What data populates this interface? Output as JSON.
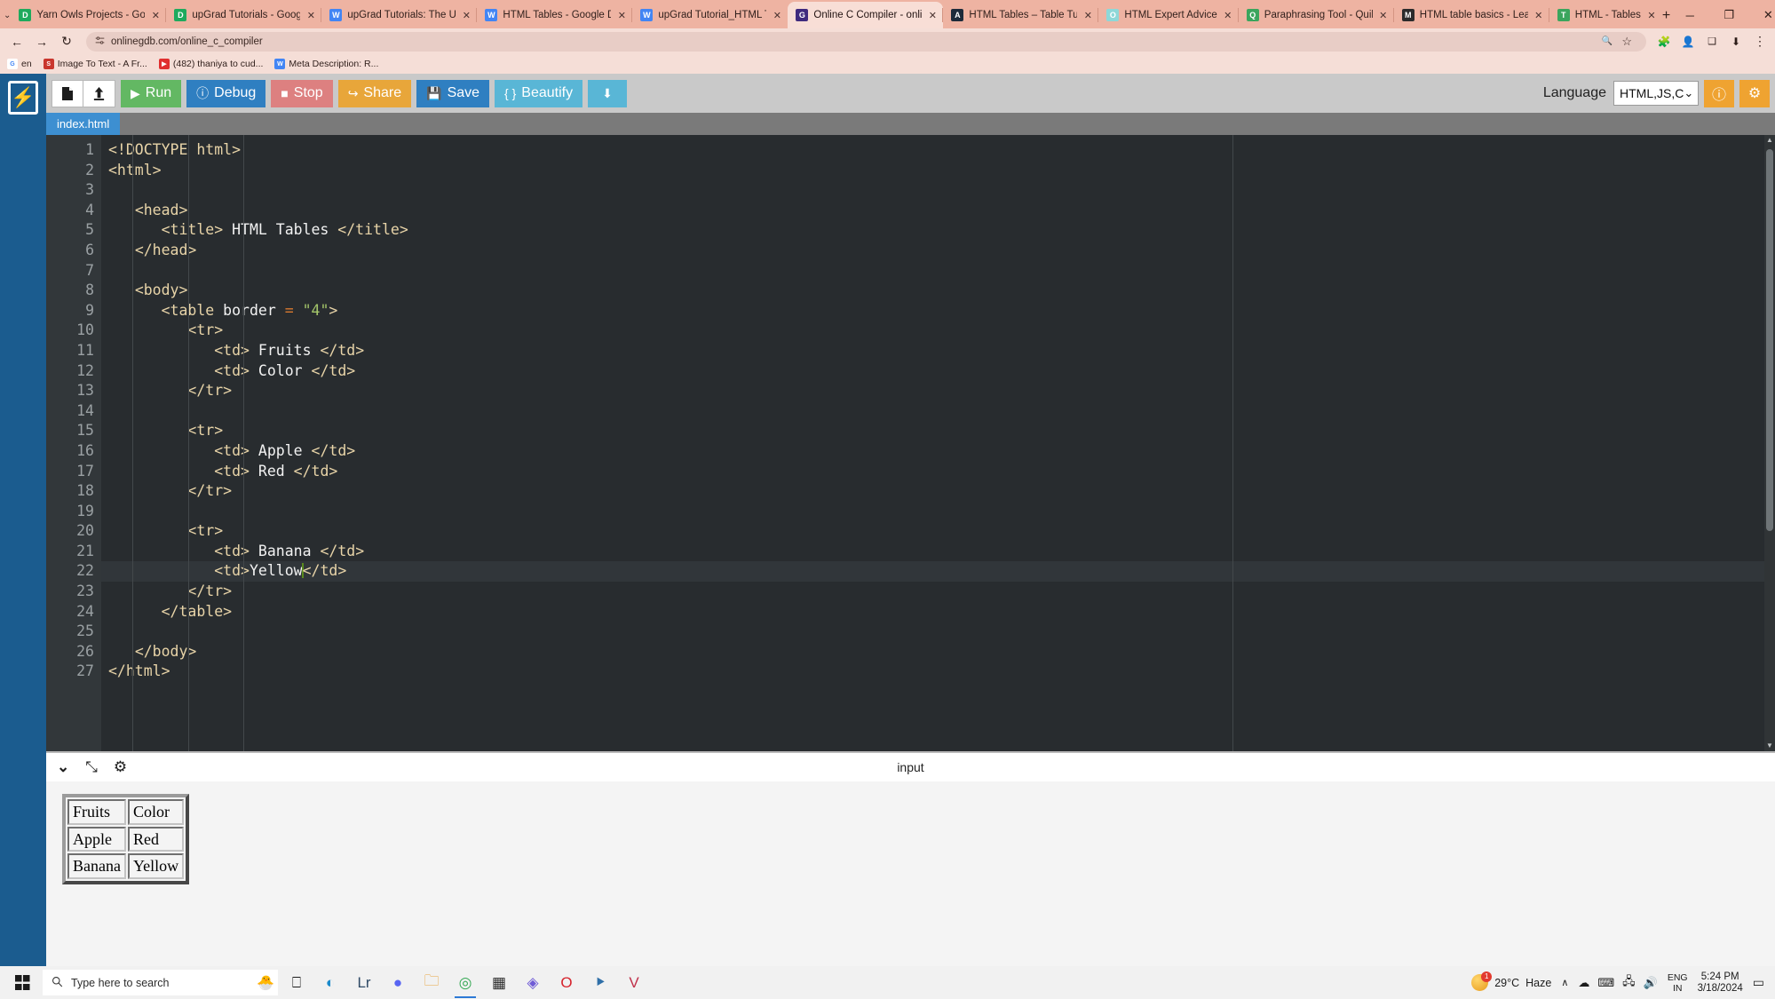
{
  "browser": {
    "tabs": [
      {
        "title": "Yarn Owls Projects - Goog",
        "fav": "D",
        "fav_color": "#1faa5d",
        "active": false
      },
      {
        "title": "upGrad Tutorials - Google",
        "fav": "D",
        "fav_color": "#1faa5d",
        "active": false
      },
      {
        "title": "upGrad Tutorials: The Ulti",
        "fav": "W",
        "fav_color": "#4285f4",
        "active": false
      },
      {
        "title": "HTML Tables - Google Do",
        "fav": "W",
        "fav_color": "#4285f4",
        "active": false
      },
      {
        "title": "upGrad Tutorial_HTML Tal",
        "fav": "W",
        "fav_color": "#4285f4",
        "active": false
      },
      {
        "title": "Online C Compiler - onlin",
        "fav": "G",
        "fav_color": "#3f2a7e",
        "active": true
      },
      {
        "title": "HTML Tables – Table Tuto",
        "fav": "A",
        "fav_color": "#1c2a3a",
        "active": false
      },
      {
        "title": "HTML Expert Advice",
        "fav": "O",
        "fav_color": "#8ed8d8",
        "active": false
      },
      {
        "title": "Paraphrasing Tool - QuillB",
        "fav": "Q",
        "fav_color": "#3ba55d",
        "active": false
      },
      {
        "title": "HTML table basics - Learn",
        "fav": "M",
        "fav_color": "#2b2b2b",
        "active": false
      },
      {
        "title": "HTML - Tables",
        "fav": "T",
        "fav_color": "#3ba55d",
        "active": false
      }
    ],
    "new_tab_label": "+",
    "tab_close_label": "✕",
    "tabstrip_chevron": "⌄",
    "window_controls": {
      "minimize": "─",
      "maximize": "❐",
      "close": "✕"
    },
    "nav": {
      "back": "←",
      "forward": "→",
      "reload": "↻"
    },
    "omnibox": {
      "site_settings_icon": "site-settings-icon",
      "url": "onlinegdb.com/online_c_compiler",
      "zoom_icon": "🔍",
      "bookmark_star": "☆"
    },
    "toolbar_icons": {
      "extensions": "🧩",
      "profile": "👤",
      "split": "❑",
      "downloads": "⬇",
      "menu": "⋮"
    },
    "bookmarks": [
      {
        "label": "en",
        "ico": "G",
        "color": "#ffffff",
        "fg": "#4285f4"
      },
      {
        "label": "Image To Text - A Fr...",
        "ico": "S",
        "color": "#c9362d",
        "fg": "#ffffff"
      },
      {
        "label": "(482) thaniya to cud...",
        "ico": "▶",
        "color": "#e02f2f",
        "fg": "#ffffff"
      },
      {
        "label": "Meta Description: R...",
        "ico": "W",
        "color": "#4285f4",
        "fg": "#ffffff"
      }
    ]
  },
  "ide": {
    "logo_glyph": "⚡",
    "toolbar": {
      "new_file_icon": "new-file-icon",
      "upload_icon": "upload-icon",
      "buttons": [
        {
          "label": "Run",
          "glyph": "▶",
          "bg": "#63b863"
        },
        {
          "label": "Debug",
          "glyph": "ⓘ",
          "bg": "#2f7fc1"
        },
        {
          "label": "Stop",
          "glyph": "■",
          "bg": "#dd8080"
        },
        {
          "label": "Share",
          "glyph": "↪",
          "bg": "#e8a63a"
        },
        {
          "label": "Save",
          "glyph": "💾",
          "bg": "#2f7fc1"
        },
        {
          "label": "Beautify",
          "glyph": "{ }",
          "bg": "#59b6d6"
        },
        {
          "label": "",
          "glyph": "⬇",
          "bg": "#59b6d6"
        }
      ],
      "language_label": "Language",
      "language_value": "HTML,JS,C",
      "language_caret": "⌄",
      "info_button": "ⓘ",
      "settings_button": "⚙"
    },
    "file_tab": "index.html",
    "editor": {
      "active_line": 22,
      "lines": [
        {
          "n": 1,
          "fold": false,
          "html": "<span class=\"tag\">&lt;!DOCTYPE html&gt;</span>"
        },
        {
          "n": 2,
          "fold": true,
          "html": "<span class=\"tag\">&lt;html&gt;</span>"
        },
        {
          "n": 3,
          "fold": false,
          "html": ""
        },
        {
          "n": 4,
          "fold": true,
          "html": "   <span class=\"tag\">&lt;head&gt;</span>"
        },
        {
          "n": 5,
          "fold": false,
          "html": "      <span class=\"tag\">&lt;title&gt;</span><span class=\"txt\"> HTML Tables </span><span class=\"tag\">&lt;/title&gt;</span>"
        },
        {
          "n": 6,
          "fold": false,
          "html": "   <span class=\"tag\">&lt;/head&gt;</span>"
        },
        {
          "n": 7,
          "fold": false,
          "html": ""
        },
        {
          "n": 8,
          "fold": false,
          "html": "   <span class=\"tag\">&lt;body&gt;</span>"
        },
        {
          "n": 9,
          "fold": true,
          "html": "      <span class=\"tag\">&lt;table</span> <span class=\"attr\">border</span> <span class=\"eq\">=</span> <span class=\"str\">\"4\"</span><span class=\"tag\">&gt;</span>"
        },
        {
          "n": 10,
          "fold": true,
          "html": "         <span class=\"tag\">&lt;tr&gt;</span>"
        },
        {
          "n": 11,
          "fold": false,
          "html": "            <span class=\"tag\">&lt;td&gt;</span><span class=\"txt\"> Fruits </span><span class=\"tag\">&lt;/td&gt;</span>"
        },
        {
          "n": 12,
          "fold": false,
          "html": "            <span class=\"tag\">&lt;td&gt;</span><span class=\"txt\"> Color </span><span class=\"tag\">&lt;/td&gt;</span>"
        },
        {
          "n": 13,
          "fold": false,
          "html": "         <span class=\"tag\">&lt;/tr&gt;</span>"
        },
        {
          "n": 14,
          "fold": false,
          "html": ""
        },
        {
          "n": 15,
          "fold": true,
          "html": "         <span class=\"tag\">&lt;tr&gt;</span>"
        },
        {
          "n": 16,
          "fold": false,
          "html": "            <span class=\"tag\">&lt;td&gt;</span><span class=\"txt\"> Apple </span><span class=\"tag\">&lt;/td&gt;</span>"
        },
        {
          "n": 17,
          "fold": false,
          "html": "            <span class=\"tag\">&lt;td&gt;</span><span class=\"txt\"> Red </span><span class=\"tag\">&lt;/td&gt;</span>"
        },
        {
          "n": 18,
          "fold": false,
          "html": "         <span class=\"tag\">&lt;/tr&gt;</span>"
        },
        {
          "n": 19,
          "fold": false,
          "html": ""
        },
        {
          "n": 20,
          "fold": true,
          "html": "         <span class=\"tag\">&lt;tr&gt;</span>"
        },
        {
          "n": 21,
          "fold": false,
          "html": "            <span class=\"tag\">&lt;td&gt;</span><span class=\"txt\"> Banana </span><span class=\"tag\">&lt;/td&gt;</span>"
        },
        {
          "n": 22,
          "fold": false,
          "html": "            <span class=\"tag\">&lt;td&gt;</span><span class=\"txt\">Yellow</span><span class=\"caret\"></span><span class=\"tag\">&lt;/td&gt;</span>"
        },
        {
          "n": 23,
          "fold": false,
          "html": "         <span class=\"tag\">&lt;/tr&gt;</span>"
        },
        {
          "n": 24,
          "fold": false,
          "html": "      <span class=\"tag\">&lt;/table&gt;</span>"
        },
        {
          "n": 25,
          "fold": false,
          "html": ""
        },
        {
          "n": 26,
          "fold": false,
          "html": "   <span class=\"tag\">&lt;/body&gt;</span>"
        },
        {
          "n": 27,
          "fold": false,
          "html": "<span class=\"tag\">&lt;/html&gt;</span>"
        }
      ]
    },
    "output_panel": {
      "collapse_icon": "⌄",
      "expand_icon": "⤡",
      "settings_icon": "⚙",
      "title": "input",
      "rendered_table": {
        "rows": [
          [
            "Fruits",
            "Color"
          ],
          [
            "Apple",
            "Red"
          ],
          [
            "Banana",
            "Yellow"
          ]
        ]
      }
    }
  },
  "taskbar": {
    "search_placeholder": "Type here to search",
    "search_icon": "🔍",
    "items": [
      {
        "name": "task-view",
        "glyph": "⎕",
        "color": "#1d1d1d",
        "running": false
      },
      {
        "name": "microsoft-edge",
        "glyph": "◐",
        "color": "#1a8acb",
        "running": false
      },
      {
        "name": "adobe-lightroom",
        "glyph": "Lr",
        "color": "#2f4a66",
        "running": false
      },
      {
        "name": "discord",
        "glyph": "●",
        "color": "#5865f2",
        "running": false
      },
      {
        "name": "file-explorer",
        "glyph": "🗀",
        "color": "#e8a33d",
        "running": false
      },
      {
        "name": "google-chrome",
        "glyph": "◎",
        "color": "#34a853",
        "running": true
      },
      {
        "name": "epic-games",
        "glyph": "▦",
        "color": "#2a2a2a",
        "running": false
      },
      {
        "name": "microsoft-copilot",
        "glyph": "◈",
        "color": "#6f5bd6",
        "running": false
      },
      {
        "name": "opera",
        "glyph": "O",
        "color": "#d6232c",
        "running": false
      },
      {
        "name": "visual-studio-code",
        "glyph": "⯈",
        "color": "#2f6fa8",
        "running": false
      },
      {
        "name": "vegas-pro",
        "glyph": "V",
        "color": "#c0304a",
        "running": false
      }
    ],
    "tray": {
      "temperature": "29°C",
      "weather": "Haze",
      "overflow": "∧",
      "icons": [
        "☁",
        "⌨",
        "🖧",
        "🔊"
      ],
      "lang_line1": "ENG",
      "lang_line2": "IN",
      "time": "5:24 PM",
      "date": "3/18/2024",
      "notification": "▭"
    }
  }
}
